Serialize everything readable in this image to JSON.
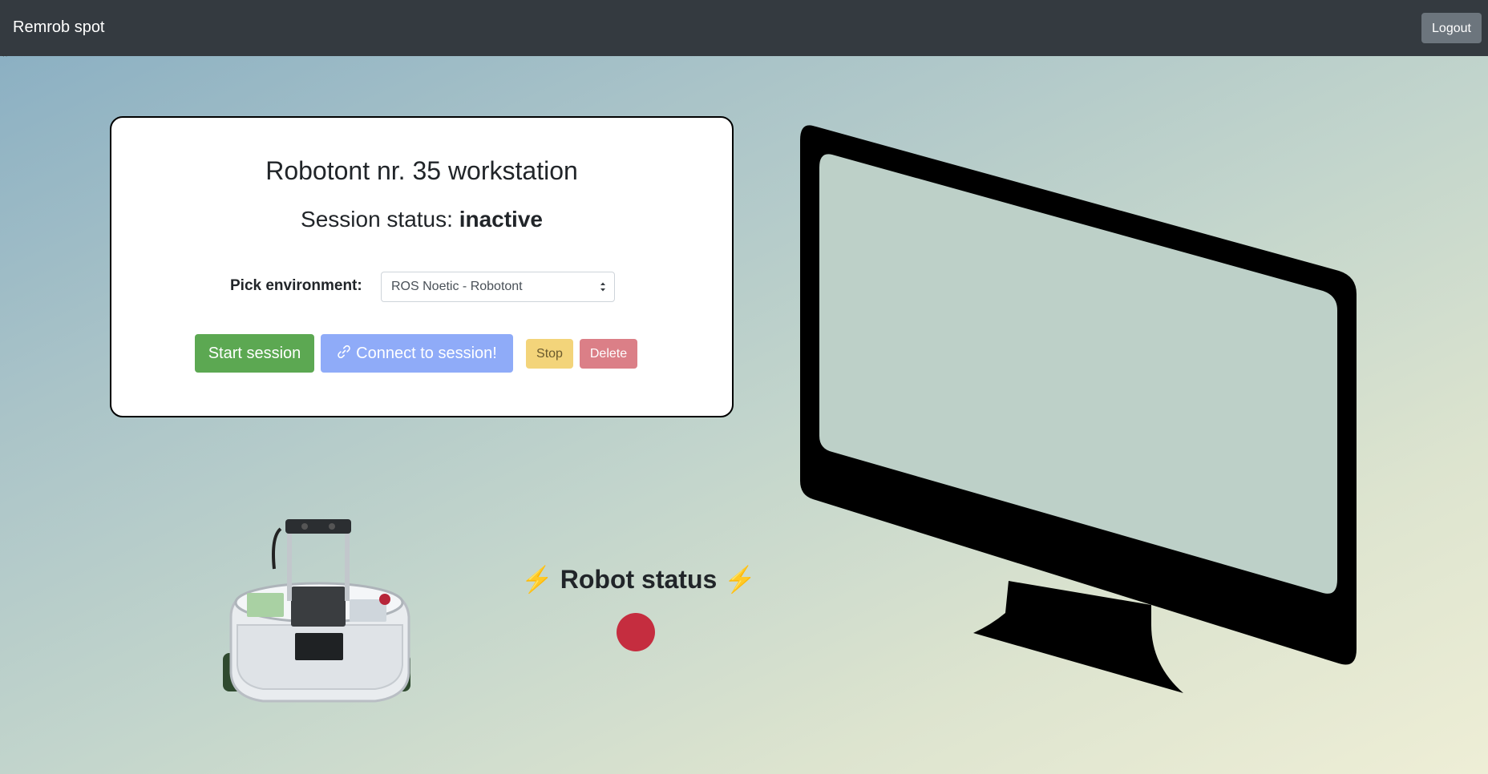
{
  "navbar": {
    "brand": "Remrob spot",
    "logout_label": "Logout"
  },
  "stray_text": "``",
  "card": {
    "title": "Robotont nr. 35 workstation",
    "status_prefix": "Session status: ",
    "status_value": "inactive",
    "environment_label": "Pick environment:",
    "environment_selected": "ROS Noetic - Robotont",
    "buttons": {
      "start": "Start session",
      "connect": "Connect to session!",
      "stop": "Stop",
      "delete": "Delete"
    }
  },
  "robot_status": {
    "bolt": "⚡",
    "title": "Robot status",
    "indicator_color": "#c52d3f"
  },
  "icons": {
    "link": "link-icon",
    "select_caret": "caret-updown-icon",
    "robot": "robot-image",
    "monitor": "monitor-illustration"
  },
  "colors": {
    "navbar_bg": "#343a40",
    "start_button": "#5ca852",
    "connect_button": "#8fabf8",
    "stop_button": "#f3d47a",
    "delete_button": "#db7f87"
  }
}
